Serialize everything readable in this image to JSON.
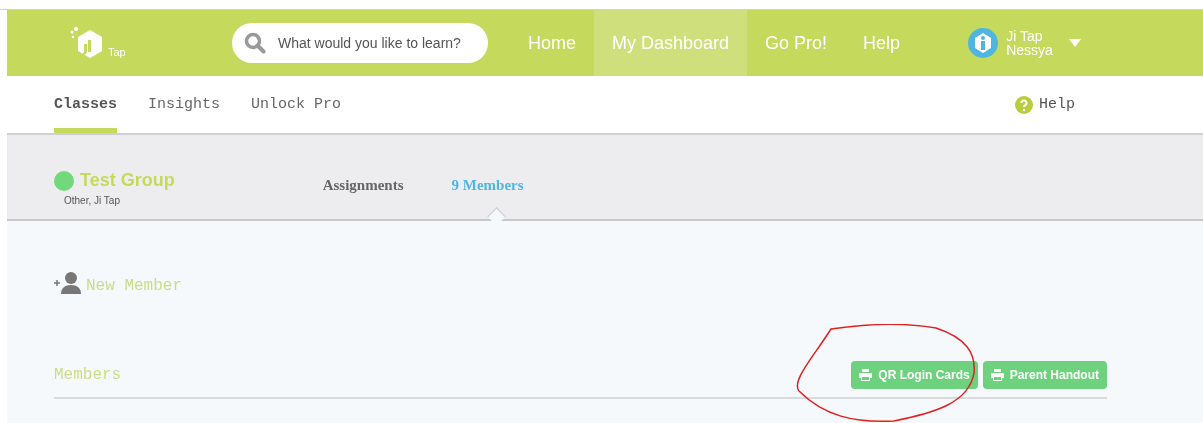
{
  "header": {
    "logo": {
      "text": "Tap"
    },
    "search": {
      "placeholder": "What would you like to learn?"
    },
    "nav": [
      {
        "label": "Home",
        "selected": false
      },
      {
        "label": "My Dashboard",
        "selected": true
      },
      {
        "label": "Go Pro!",
        "selected": false
      },
      {
        "label": "Help",
        "selected": false
      }
    ],
    "user": {
      "name_lines": [
        "Ji Tap",
        "Nessya"
      ]
    }
  },
  "subnav": {
    "tabs": [
      {
        "label": "Classes",
        "selected": true
      },
      {
        "label": "Insights",
        "selected": false
      },
      {
        "label": "Unlock Pro",
        "selected": false
      }
    ],
    "help": "Help"
  },
  "group": {
    "name": "Test Group",
    "subtitle": "Other, Ji Tap",
    "tabs": [
      {
        "label": "Assignments",
        "selected": false
      },
      {
        "label": "9 Members",
        "selected": true
      }
    ]
  },
  "new_member": "New Member",
  "members": {
    "title": "Members",
    "buttons": [
      "QR Login Cards",
      "Parent Handout"
    ]
  }
}
